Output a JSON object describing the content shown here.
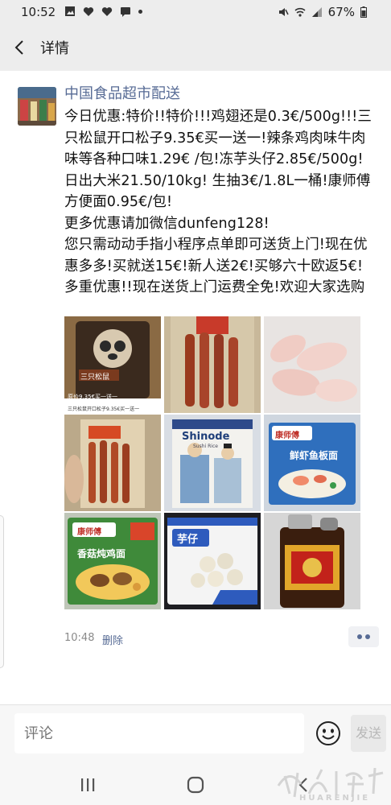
{
  "status_bar": {
    "time": "10:52",
    "battery": "67%",
    "left_icons": [
      "image-icon",
      "heart-icon",
      "heart-icon",
      "message-icon",
      "dot-icon"
    ],
    "right_icons": [
      "mute-icon",
      "wifi-icon",
      "signal-icon",
      "battery-icon"
    ]
  },
  "header": {
    "back_icon": "chevron-left-icon",
    "title": "详情"
  },
  "post": {
    "author": "中国食品超市配送",
    "paragraphs": [
      "今日优惠:特价!!特价!!!鸡翅还是0.3€/500g!!!三只松鼠开口松子9.35€买一送一!辣条鸡肉味牛肉味等各种口味1.29€ /包!冻芋头仔2.85€/500g!日出大米21.50/10kg! 生抽3€/1.8L一桶!康师傅方便面0.95€/包!",
      "更多优惠请加微信dunfeng128!",
      "您只需动动手指小程序点单即可送货上门!现在优惠多多!买就送15€!新人送2€!买够六十欧返5€!多重优惠!!现在送货上门运费全免!欢迎大家选购"
    ],
    "image_captions": {
      "img1_main": "三只松鼠",
      "img1_sub": "原价9.35€买一送一",
      "img1_small": "三只松鼠开口松子9.35€买一送一",
      "img3_brand": "Shinode",
      "img3_sub": "Sushi Rice",
      "img5_brand": "康师傅",
      "img5_name": "鲜虾鱼板面",
      "img7_brand": "康师傅",
      "img7_name": "香菇炖鸡面",
      "img8_name": "芋仔"
    },
    "time": "10:48",
    "delete_label": "删除"
  },
  "comment": {
    "placeholder": "评论",
    "emoji_icon": "smiley-icon",
    "send_label": "发送"
  },
  "nav": {
    "icons": [
      "recents-icon",
      "home-icon",
      "back-icon"
    ]
  },
  "watermark": {
    "text": "HUARENJIE"
  }
}
